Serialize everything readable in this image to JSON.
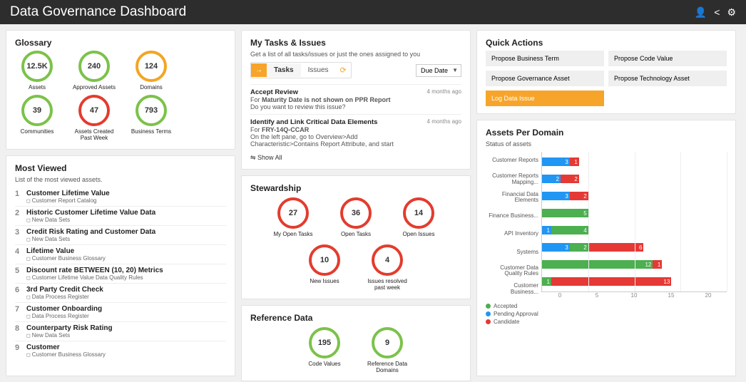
{
  "header": {
    "title": "Data Governance Dashboard"
  },
  "glossary": {
    "title": "Glossary",
    "rings": [
      {
        "value": "12.5K",
        "label": "Assets",
        "color": "green"
      },
      {
        "value": "240",
        "label": "Approved Assets",
        "color": "green"
      },
      {
        "value": "124",
        "label": "Domains",
        "color": "orange"
      },
      {
        "value": "39",
        "label": "Communities",
        "color": "green"
      },
      {
        "value": "47",
        "label": "Assets Created Past Week",
        "color": "red"
      },
      {
        "value": "793",
        "label": "Business Terms",
        "color": "green"
      }
    ]
  },
  "most_viewed": {
    "title": "Most Viewed",
    "subtitle": "List of the most viewed assets.",
    "items": [
      {
        "n": "1",
        "title": "Customer Lifetime Value",
        "sub": "Customer Report Catalog"
      },
      {
        "n": "2",
        "title": "Historic Customer Lifetime Value Data",
        "sub": "New Data Sets"
      },
      {
        "n": "3",
        "title": "Credit Risk Rating and Customer Data",
        "sub": "New Data Sets"
      },
      {
        "n": "4",
        "title": "Lifetime Value",
        "sub": "Customer Business Glossary"
      },
      {
        "n": "5",
        "title": "Discount rate BETWEEN (10, 20) Metrics",
        "sub": "Customer Lifetime Value Data Quality Rules"
      },
      {
        "n": "6",
        "title": "3rd Party Credit Check",
        "sub": "Data Process Register"
      },
      {
        "n": "7",
        "title": "Customer Onboarding",
        "sub": "Data Process Register"
      },
      {
        "n": "8",
        "title": "Counterparty Risk Rating",
        "sub": "New Data Sets"
      },
      {
        "n": "9",
        "title": "Customer",
        "sub": "Customer Business Glossary"
      }
    ]
  },
  "tasks": {
    "title": "My Tasks & Issues",
    "subtitle": "Get a list of all tasks/issues or just the ones assigned to you",
    "tabs": {
      "tasks": "Tasks",
      "issues": "Issues"
    },
    "sort": "Due Date",
    "show_all": "Show All",
    "items": [
      {
        "title": "Accept Review",
        "age": "4 months ago",
        "line": "For <b>Maturity Date is not shown on PPR Report</b>",
        "sub": "Do you want to review this issue?"
      },
      {
        "title": "Identify and Link Critical Data Elements",
        "age": "4 months ago",
        "line": "For <b>FRY-14Q-CCAR</b>",
        "sub": "On the left pane, go to Overview>Add Characteristic>Contains Report Attribute, and start"
      }
    ]
  },
  "stewardship": {
    "title": "Stewardship",
    "rings": [
      {
        "value": "27",
        "label": "My Open Tasks",
        "color": "red"
      },
      {
        "value": "36",
        "label": "Open Tasks",
        "color": "red"
      },
      {
        "value": "14",
        "label": "Open Issues",
        "color": "red"
      },
      {
        "value": "10",
        "label": "New Issues",
        "color": "red"
      },
      {
        "value": "4",
        "label": "Issues resolved past week",
        "color": "red"
      }
    ]
  },
  "reference": {
    "title": "Reference Data",
    "rings": [
      {
        "value": "195",
        "label": "Code Values",
        "color": "green"
      },
      {
        "value": "9",
        "label": "Reference Data Domains",
        "color": "green"
      }
    ]
  },
  "quick_actions": {
    "title": "Quick Actions",
    "buttons": [
      "Propose Business Term",
      "Propose Code Value",
      "Propose Governance Asset",
      "Propose Technology Asset"
    ],
    "primary": "Log Data Issue"
  },
  "chart_data": {
    "type": "bar",
    "title": "Assets Per Domain",
    "subtitle": "Status of assets",
    "orientation": "horizontal",
    "stacked": true,
    "xlabel": "",
    "ylabel": "",
    "xlim": [
      0,
      20
    ],
    "xticks": [
      0,
      5,
      10,
      15,
      20
    ],
    "categories": [
      "Customer Reports",
      "Customer Reports Mapping...",
      "Financial Data Elements",
      "Finance Business...",
      "API Inventory",
      "Systems",
      "Customer Data Quality Rules",
      "Customer Business..."
    ],
    "series": [
      {
        "name": "Accepted",
        "color": "#2196f3",
        "values": [
          3,
          2,
          3,
          0,
          1,
          3,
          0,
          0
        ]
      },
      {
        "name": "Pending Approval",
        "color": "#4caf50",
        "values": [
          0,
          0,
          0,
          5,
          4,
          2,
          12,
          1
        ]
      },
      {
        "name": "Candidate",
        "color": "#e53935",
        "values": [
          1,
          2,
          2,
          0,
          0,
          6,
          1,
          13
        ]
      }
    ],
    "legend": [
      "Accepted",
      "Pending Approval",
      "Candidate"
    ]
  }
}
